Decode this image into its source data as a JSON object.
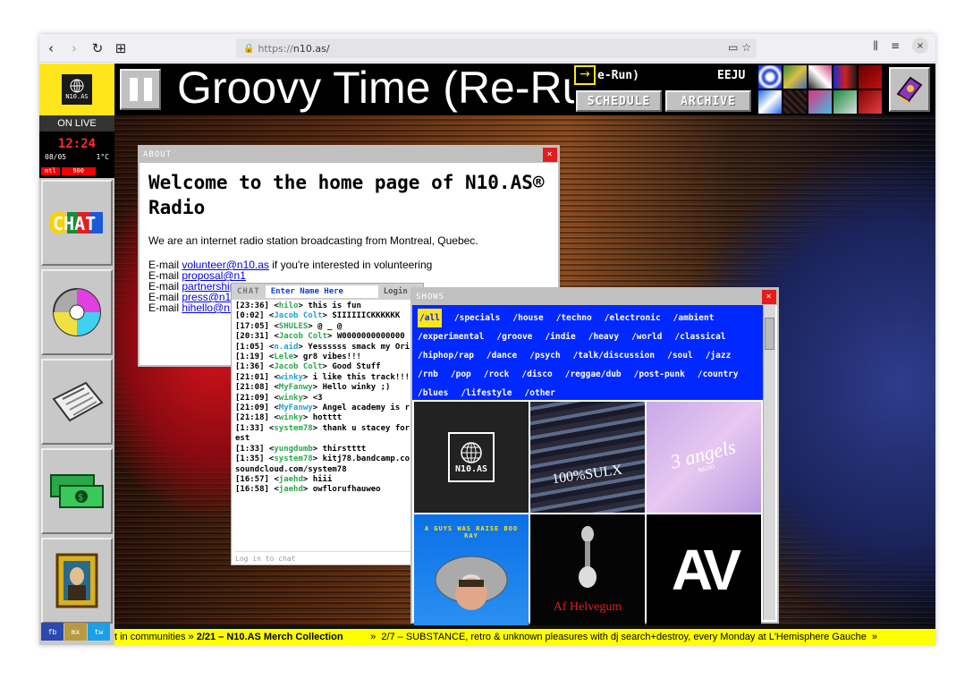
{
  "browser": {
    "url_protocol": "https://",
    "url_host": "n10.as/"
  },
  "sidebar": {
    "logo_text": "N10.AS",
    "on_live": "ON LIVE",
    "clock_time": "12:24",
    "clock_date": "08/05",
    "clock_temp": "1°C",
    "tag_left": "mtl",
    "tag_right": "900",
    "social": [
      "fb",
      "mx",
      "tw"
    ]
  },
  "header": {
    "now_playing": "Groovy Time (Re-Run)",
    "mini_title": "e-Run)",
    "mini_title_2": "EEJU",
    "schedule": "SCHEDULE",
    "archive": "ARCHIVE"
  },
  "about": {
    "title": "ABOUT",
    "heading": "Welcome to the home page of N10.AS® Radio",
    "intro": "We are an internet radio station broadcasting from Montreal, Quebec.",
    "email_lines": [
      {
        "prefix": "E-mail ",
        "link": "volunteer@n10.as",
        "suffix": " if you're interested in volunteering"
      },
      {
        "prefix": "E-mail ",
        "link": "proposal@n1",
        "suffix": ""
      },
      {
        "prefix": "E-mail ",
        "link": "partnerships",
        "suffix": ""
      },
      {
        "prefix": "E-mail ",
        "link": "press@n10.",
        "suffix": ""
      },
      {
        "prefix": "E-mail ",
        "link": "hihello@n10",
        "suffix": ""
      }
    ]
  },
  "chat": {
    "label": "CHAT",
    "name_placeholder": "Enter Name Here",
    "login_btn": "Login",
    "messages": [
      {
        "time": "[23:36]",
        "user": "hilo",
        "text": "this is fun"
      },
      {
        "time": "[0:02]",
        "user": "Jacob Colt",
        "text": "SIIIIIICKKKKKK"
      },
      {
        "time": "[17:05]",
        "user": "SHULES",
        "text": "@ _ @"
      },
      {
        "time": "[20:31]",
        "user": "Jacob Colt",
        "text": "W0000000000000"
      },
      {
        "time": "[1:05]",
        "user": "n.aid",
        "text": "Yessssss smack my Ori"
      },
      {
        "time": "[1:19]",
        "user": "Lele",
        "text": "gr8 vibes!!!"
      },
      {
        "time": "[1:36]",
        "user": "Jacob Colt",
        "text": "Good Stuff"
      },
      {
        "time": "[21:01]",
        "user": "winky",
        "text": "i like this track!!!"
      },
      {
        "time": "[21:08]",
        "user": "MyFanwy",
        "text": "Hello winky ;)"
      },
      {
        "time": "[21:09]",
        "user": "winky",
        "text": "<3"
      },
      {
        "time": "[21:09]",
        "user": "MyFanwy",
        "text": "Angel academy is r"
      },
      {
        "time": "[21:18]",
        "user": "winky",
        "text": "hotttt"
      },
      {
        "time": "[1:33]",
        "user": "system78",
        "text": "thank u stacey for"
      },
      {
        "time": "",
        "user": "",
        "text": "est"
      },
      {
        "time": "[1:33]",
        "user": "yungdumb",
        "text": "thirstttt"
      },
      {
        "time": "[1:35]",
        "user": "system78",
        "text": "kitj78.bandcamp.co"
      },
      {
        "time": "",
        "user": "",
        "text": "soundcloud.com/system78"
      },
      {
        "time": "[16:57]",
        "user": "jaehd",
        "text": "hiii"
      },
      {
        "time": "[16:58]",
        "user": "jaehd",
        "text": "owflorufhauweo"
      }
    ],
    "login_prompt": "Log in to chat"
  },
  "shows": {
    "title": "SHOWS",
    "genres": [
      "/all",
      "/specials",
      "/house",
      "/techno",
      "/electronic",
      "/ambient",
      "/experimental",
      "/groove",
      "/indie",
      "/heavy",
      "/world",
      "/classical",
      "/hiphop/rap",
      "/dance",
      "/psych",
      "/talk/discussion",
      "/soul",
      "/jazz",
      "/rnb",
      "/pop",
      "/rock",
      "/disco",
      "/reggae/dub",
      "/post-punk",
      "/country",
      "/blues",
      "/lifestyle",
      "/other"
    ],
    "tiles": [
      {
        "label": "N10.AS"
      },
      {
        "label": "100%SULX"
      },
      {
        "label": "3 angels",
        "sub": "RADIO"
      },
      {
        "label": "A GUYS WAS RAISE BOO RAY"
      },
      {
        "label": "Af Helvegum"
      },
      {
        "label": "AV"
      }
    ]
  },
  "ticker": {
    "part1": "t in communities  »  ",
    "part2": "2/21 – N10.AS Merch Collection",
    "part3": "          »  2/7 – SUBSTANCE, retro & unknown pleasures with dj search+destroy, every Monday at L'Hemisphere Gauche  »"
  },
  "colors": {
    "accent_yellow": "#ffe51b",
    "shows_blue": "#0028ff",
    "close_red": "#e41c1c",
    "ticker_yellow": "#ffff00"
  }
}
